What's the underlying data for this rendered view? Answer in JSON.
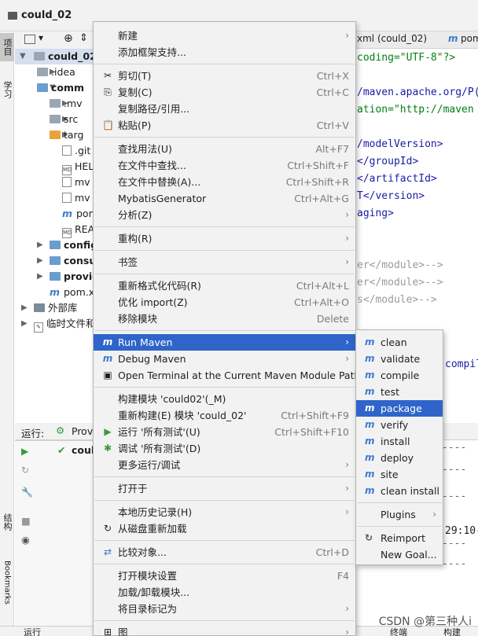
{
  "window": {
    "title": "could_02"
  },
  "left_tabs": {
    "project": "项目",
    "learn": "学习",
    "structure": "结构",
    "bookmarks": "Bookmarks"
  },
  "tree": {
    "root": "could_02",
    "items": [
      {
        "label": ".idea",
        "kind": "folder"
      },
      {
        "label": "comm",
        "kind": "folder-blue"
      },
      {
        "label": ".mv",
        "kind": "folder"
      },
      {
        "label": "src",
        "kind": "folder"
      },
      {
        "label": "targ",
        "kind": "folder-orange"
      },
      {
        "label": ".git",
        "kind": "file"
      },
      {
        "label": "HEL",
        "kind": "md"
      },
      {
        "label": "mv",
        "kind": "file"
      },
      {
        "label": "mv",
        "kind": "file"
      },
      {
        "label": "pon",
        "kind": "maven"
      },
      {
        "label": "REA",
        "kind": "md"
      },
      {
        "label": "config",
        "kind": "folder-blue"
      },
      {
        "label": "consu",
        "kind": "folder-blue"
      },
      {
        "label": "provid",
        "kind": "folder-blue"
      },
      {
        "label": "pom.x",
        "kind": "maven"
      },
      {
        "label": "外部库",
        "kind": "lib"
      },
      {
        "label": "临时文件和",
        "kind": "scratch"
      }
    ]
  },
  "editor": {
    "tabs": [
      "xml (could_02)",
      "pom"
    ],
    "lines": [
      {
        "t": "coding=\"UTF-8\"?>"
      },
      {
        "t": "/maven.apache.org/P("
      },
      {
        "t": "ation=\"http://maven"
      },
      {
        "t": "/modelVersion>"
      },
      {
        "t": "</groupId>"
      },
      {
        "t": "</artifactId>"
      },
      {
        "t": "T</version>"
      },
      {
        "t": "aging>"
      },
      {
        "t": "er</module>-->"
      },
      {
        "t": "er</module>-->"
      },
      {
        "t": "s</module>-->"
      },
      {
        "t": "compil"
      }
    ]
  },
  "run": {
    "label": "运行:",
    "tab": "Prov",
    "item": "coul",
    "console_time": "29:10-"
  },
  "context_menu": {
    "items": [
      {
        "label": "新建",
        "shortcut": "",
        "submenu": true,
        "icon": ""
      },
      {
        "label": "添加框架支持...",
        "shortcut": "",
        "submenu": false,
        "icon": ""
      },
      {
        "sep": true
      },
      {
        "label": "剪切(T)",
        "shortcut": "Ctrl+X",
        "submenu": false,
        "icon": "✂"
      },
      {
        "label": "复制(C)",
        "shortcut": "Ctrl+C",
        "submenu": false,
        "icon": "⎘"
      },
      {
        "label": "复制路径/引用...",
        "shortcut": "",
        "submenu": false,
        "icon": ""
      },
      {
        "label": "粘贴(P)",
        "shortcut": "Ctrl+V",
        "submenu": false,
        "icon": "📋"
      },
      {
        "sep": true
      },
      {
        "label": "查找用法(U)",
        "shortcut": "Alt+F7",
        "submenu": false,
        "icon": ""
      },
      {
        "label": "在文件中查找...",
        "shortcut": "Ctrl+Shift+F",
        "submenu": false,
        "icon": ""
      },
      {
        "label": "在文件中替换(A)...",
        "shortcut": "Ctrl+Shift+R",
        "submenu": false,
        "icon": ""
      },
      {
        "label": "MybatisGenerator",
        "shortcut": "Ctrl+Alt+G",
        "submenu": false,
        "icon": ""
      },
      {
        "label": "分析(Z)",
        "shortcut": "",
        "submenu": true,
        "icon": ""
      },
      {
        "sep": true
      },
      {
        "label": "重构(R)",
        "shortcut": "",
        "submenu": true,
        "icon": ""
      },
      {
        "sep": true
      },
      {
        "label": "书签",
        "shortcut": "",
        "submenu": true,
        "icon": ""
      },
      {
        "sep": true
      },
      {
        "label": "重新格式化代码(R)",
        "shortcut": "Ctrl+Alt+L",
        "submenu": false,
        "icon": ""
      },
      {
        "label": "优化 import(Z)",
        "shortcut": "Ctrl+Alt+O",
        "submenu": false,
        "icon": ""
      },
      {
        "label": "移除模块",
        "shortcut": "Delete",
        "submenu": false,
        "icon": ""
      },
      {
        "sep": true
      },
      {
        "label": "Run Maven",
        "shortcut": "",
        "submenu": true,
        "icon": "m",
        "highlight": true
      },
      {
        "label": "Debug Maven",
        "shortcut": "",
        "submenu": true,
        "icon": "m"
      },
      {
        "label": "Open Terminal at the Current Maven Module Path",
        "shortcut": "",
        "submenu": false,
        "icon": "▣"
      },
      {
        "sep": true
      },
      {
        "label": "构建模块 'could02'(_M)",
        "shortcut": "",
        "submenu": false,
        "icon": ""
      },
      {
        "label": "重新构建(E) 模块 'could_02'",
        "shortcut": "Ctrl+Shift+F9",
        "submenu": false,
        "icon": ""
      },
      {
        "label": "运行 '所有测试'(U)",
        "shortcut": "Ctrl+Shift+F10",
        "submenu": false,
        "icon": "▶"
      },
      {
        "label": "调试 '所有测试'(D)",
        "shortcut": "",
        "submenu": false,
        "icon": "✱"
      },
      {
        "label": "更多运行/调试",
        "shortcut": "",
        "submenu": true,
        "icon": ""
      },
      {
        "sep": true
      },
      {
        "label": "打开于",
        "shortcut": "",
        "submenu": true,
        "icon": ""
      },
      {
        "sep": true
      },
      {
        "label": "本地历史记录(H)",
        "shortcut": "",
        "submenu": true,
        "icon": ""
      },
      {
        "label": "从磁盘重新加载",
        "shortcut": "",
        "submenu": false,
        "icon": "↻"
      },
      {
        "sep": true
      },
      {
        "label": "比较对象...",
        "shortcut": "Ctrl+D",
        "submenu": false,
        "icon": "⇄"
      },
      {
        "sep": true
      },
      {
        "label": "打开模块设置",
        "shortcut": "F4",
        "submenu": false,
        "icon": ""
      },
      {
        "label": "加载/卸载模块...",
        "shortcut": "",
        "submenu": false,
        "icon": ""
      },
      {
        "label": "将目录标记为",
        "shortcut": "",
        "submenu": true,
        "icon": ""
      },
      {
        "sep": true
      },
      {
        "label": "图",
        "shortcut": "",
        "submenu": true,
        "icon": "⊞"
      }
    ]
  },
  "submenu": {
    "items": [
      {
        "label": "clean"
      },
      {
        "label": "validate"
      },
      {
        "label": "compile"
      },
      {
        "label": "test"
      },
      {
        "label": "package",
        "highlight": true
      },
      {
        "label": "verify"
      },
      {
        "label": "install"
      },
      {
        "label": "deploy"
      },
      {
        "label": "site"
      },
      {
        "label": "clean install"
      },
      {
        "sep": true
      },
      {
        "label": "Plugins",
        "submenu": true
      },
      {
        "sep": true
      },
      {
        "label": "Reimport",
        "icon": "↻"
      },
      {
        "label": "New Goal..."
      }
    ]
  },
  "bottom": {
    "run_tab": "运行",
    "build_tab": "构建",
    "terminal_tab": "终端"
  },
  "watermark": "CSDN @第三种人i"
}
